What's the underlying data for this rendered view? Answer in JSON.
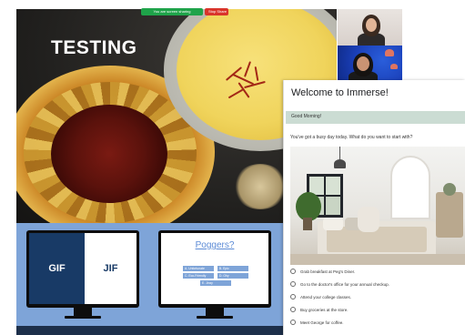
{
  "share": {
    "title": "TESTING"
  },
  "zoom_bar": {
    "status": "You are screen sharing",
    "stop_label": "Stop Share"
  },
  "form": {
    "title": "Welcome to Immerse!",
    "greeting": "Good Morning!",
    "question": "You've got a busy day today. What do you want to start with?",
    "options": [
      "Grab breakfast at Peg's Diner.",
      "Go to the doctor's office for your annual checkup.",
      "Attend your college classes.",
      "Buy groceries at the store.",
      "Meet George for coffee."
    ],
    "accent_color": "#cbdcd3"
  },
  "slides": {
    "left": {
      "gif_label": "GIF",
      "jif_label": "JIF"
    },
    "right": {
      "title": "Poggers?",
      "options": [
        "A. Unfortunate",
        "B. Epic",
        "C. Eco-Friendly",
        "D. Ohy",
        "E. Jinxy"
      ]
    },
    "band_color": "#7ea4d8"
  }
}
